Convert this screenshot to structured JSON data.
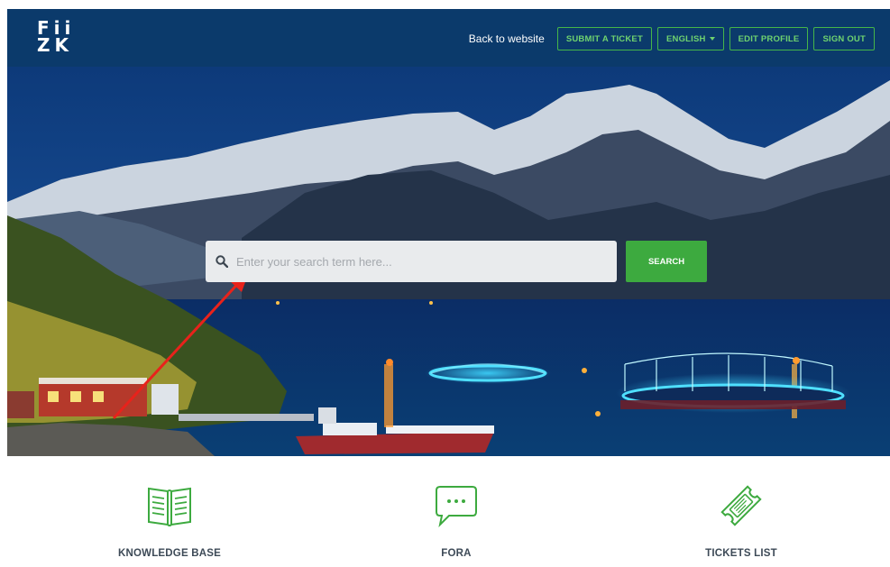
{
  "header": {
    "logo_line1": "Fii",
    "logo_line2": "ZK",
    "back_link": "Back to website",
    "submit_ticket": "SUBMIT A TICKET",
    "language": "ENGLISH",
    "edit_profile": "EDIT PROFILE",
    "sign_out": "SIGN OUT"
  },
  "search": {
    "placeholder": "Enter your search term here...",
    "button": "SEARCH"
  },
  "tiles": [
    {
      "label": "KNOWLEDGE BASE",
      "icon": "book-icon"
    },
    {
      "label": "FORA",
      "icon": "chat-bubble-icon"
    },
    {
      "label": "TICKETS LIST",
      "icon": "ticket-icon"
    }
  ],
  "colors": {
    "header_bg": "#0b3a6b",
    "accent_green": "#3daa3f",
    "annotation_arrow": "#e8221b"
  }
}
